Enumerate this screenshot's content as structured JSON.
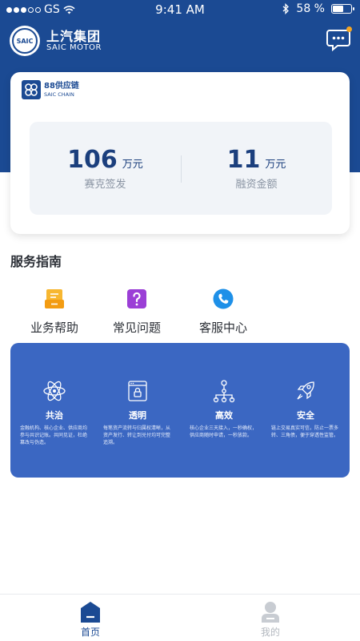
{
  "status_bar": {
    "carrier": "GS",
    "time": "9:41 AM",
    "battery": "58 %",
    "battery_level": 0.58
  },
  "header": {
    "brand_cn": "上汽集团",
    "brand_en": "SAIC MOTOR",
    "logo_text": "SAIC"
  },
  "summary": {
    "logo_cn": "88供应链",
    "logo_en": "SAIC CHAIN",
    "stats": [
      {
        "value": "106",
        "unit": "万元",
        "label": "赛克签发"
      },
      {
        "value": "11",
        "unit": "万元",
        "label": "融资金额"
      }
    ]
  },
  "services": {
    "title": "服务指南",
    "items": [
      {
        "label": "业务帮助",
        "icon": "business-help-icon"
      },
      {
        "label": "常见问题",
        "icon": "faq-icon"
      },
      {
        "label": "客服中心",
        "icon": "customer-service-icon"
      }
    ]
  },
  "features": [
    {
      "title": "共治",
      "icon": "atom-icon",
      "desc": "金融机构、核心企业、供应商均参与共识记账。共同见证，杜绝篡改与伪造。"
    },
    {
      "title": "透明",
      "icon": "browser-lock-icon",
      "desc": "每笔资产流转与归属权清晰，从资产发行、转让到兑付均可完整追溯。"
    },
    {
      "title": "高效",
      "icon": "network-icon",
      "desc": "核心企业三天接入，一秒确权，供应商随时申请，一秒放款。"
    },
    {
      "title": "安全",
      "icon": "rocket-icon",
      "desc": "链上交易真实可信，防止一票多转、三角债，便于穿透性监管。"
    }
  ],
  "tabs": [
    {
      "label": "首页",
      "active": true
    },
    {
      "label": "我的",
      "active": false
    }
  ],
  "colors": {
    "primary": "#1b4a93",
    "feature_panel": "#3b67c2",
    "notification_dot": "#f5a623"
  }
}
